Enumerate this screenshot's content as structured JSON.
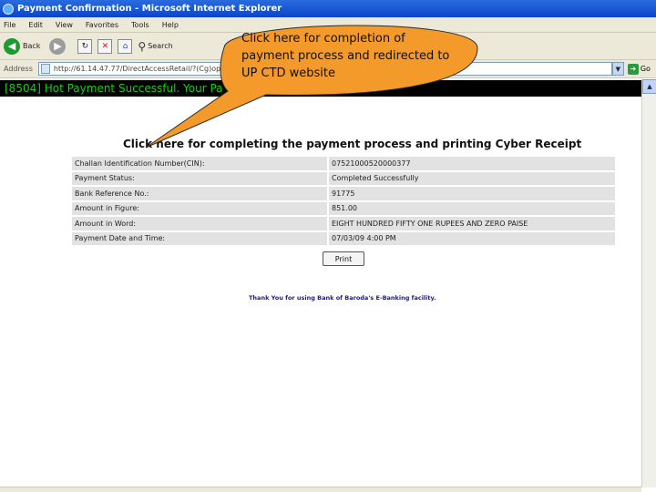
{
  "window": {
    "title": "Payment Confirmation - Microsoft Internet Explorer"
  },
  "menu": {
    "items": [
      "File",
      "Edit",
      "View",
      "Favorites",
      "Tools",
      "Help"
    ]
  },
  "toolbar": {
    "back_label": "Back",
    "search_label": "Search"
  },
  "address": {
    "label": "Address",
    "url": "http://61.14.47.77/DirectAccessRetail/?(Cg)op...Request?F=00974447",
    "go_label": "Go"
  },
  "banner": {
    "text": "[8504]  Hot Payment Successful. Your Pa"
  },
  "callout": {
    "text": "Click here for completion of payment process and redirected to UP CTD website"
  },
  "receipt": {
    "heading": "Click here for completing the payment process and printing Cyber Receipt",
    "rows": [
      {
        "label": "Challan Identification Number(CIN):",
        "value": "07521000520000377"
      },
      {
        "label": "Payment Status:",
        "value": "Completed Successfully"
      },
      {
        "label": "Bank Reference No.:",
        "value": "91775"
      },
      {
        "label": "Amount in Figure:",
        "value": "851.00"
      },
      {
        "label": "Amount in Word:",
        "value": "EIGHT HUNDRED FIFTY ONE RUPEES AND ZERO PAISE"
      },
      {
        "label": "Payment Date and Time:",
        "value": "07/03/09 4:00 PM"
      }
    ],
    "print_label": "Print"
  },
  "footer": {
    "thanks": "Thank You for using Bank of Baroda's E-Banking facility."
  }
}
